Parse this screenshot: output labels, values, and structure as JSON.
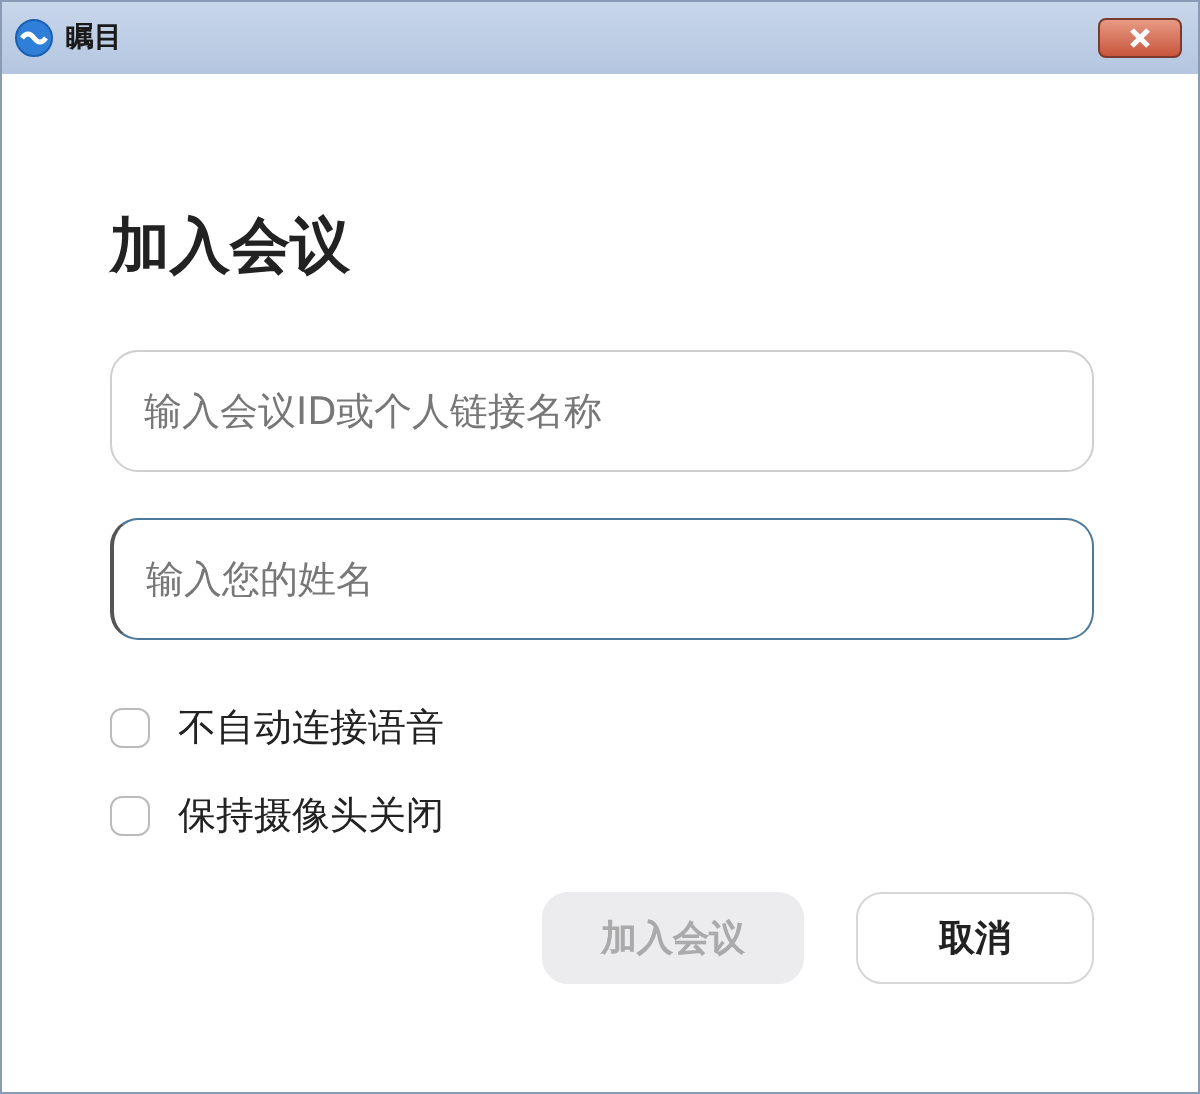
{
  "window": {
    "title": "瞩目"
  },
  "heading": "加入会议",
  "fields": [
    {
      "placeholder": "输入会议ID或个人链接名称",
      "focused": false
    },
    {
      "placeholder": "输入您的姓名",
      "focused": true
    }
  ],
  "options": [
    {
      "label": "不自动连接语音",
      "checked": false
    },
    {
      "label": "保持摄像头关闭",
      "checked": false
    }
  ],
  "buttons": [
    {
      "label": "加入会议",
      "disabled": true
    },
    {
      "label": "取消",
      "disabled": false
    }
  ]
}
